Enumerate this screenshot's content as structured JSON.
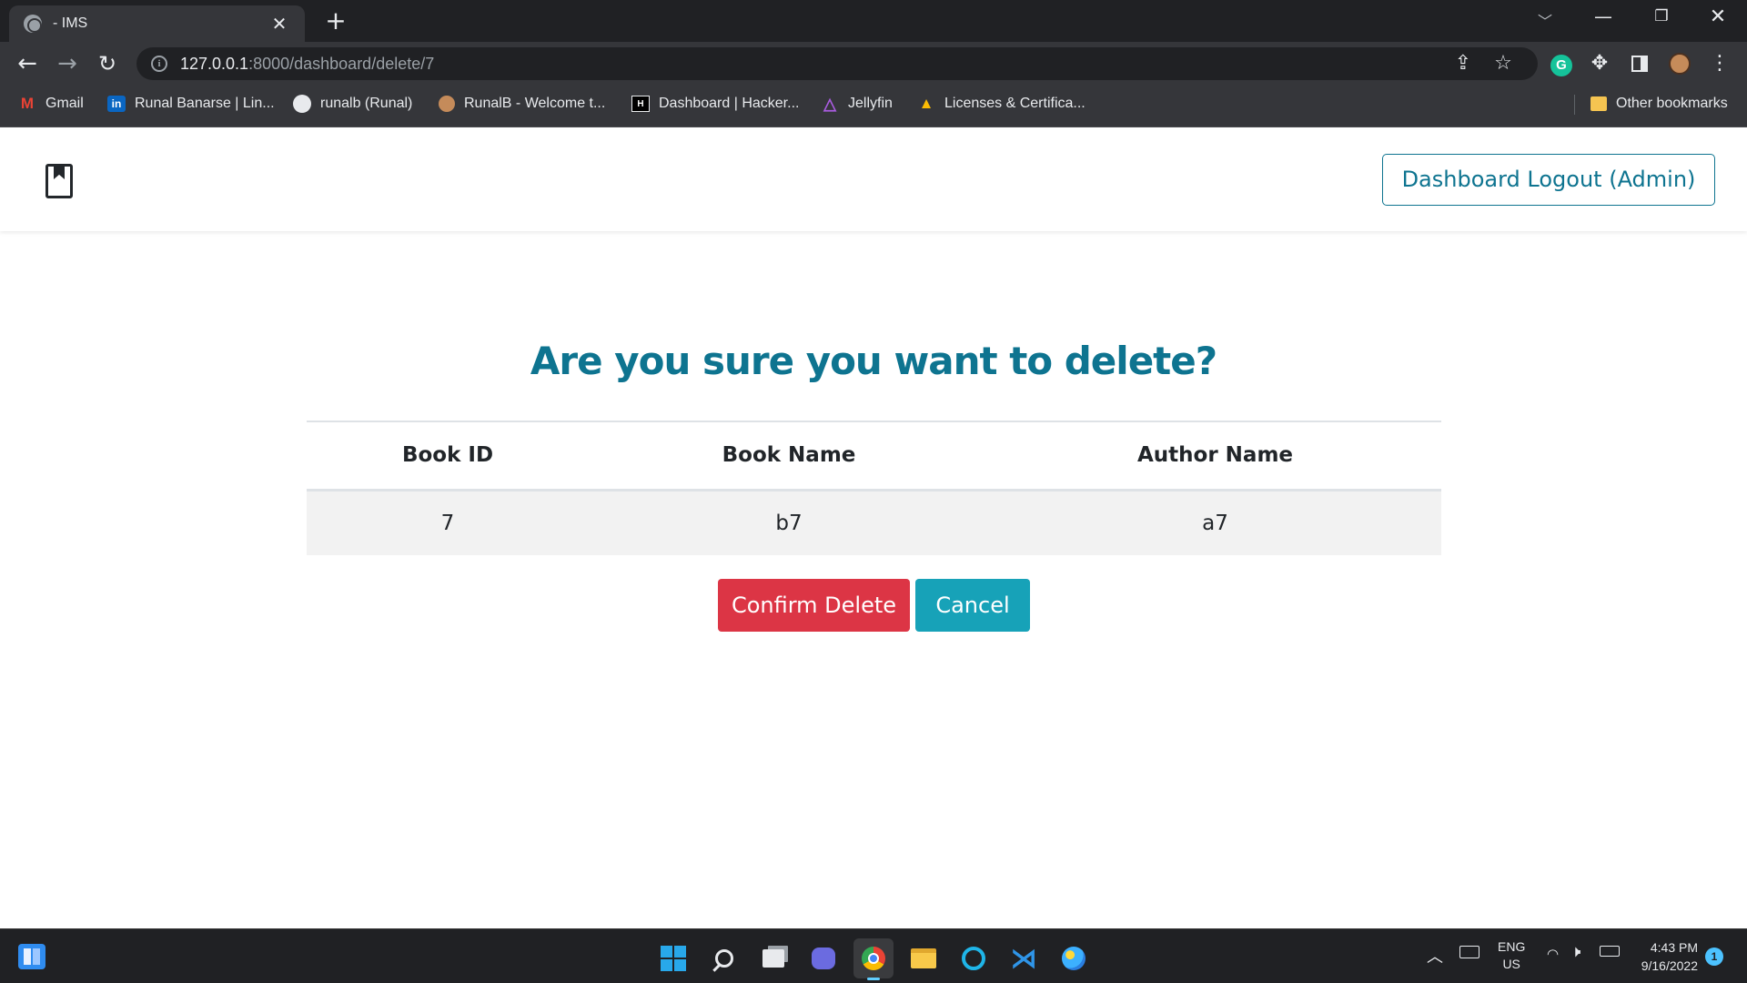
{
  "browser": {
    "tab_title": "- IMS",
    "url_host": "127.0.0.1",
    "url_path": ":8000/dashboard/delete/7",
    "bookmarks": [
      {
        "label": "Gmail",
        "icon": "gmail-icon"
      },
      {
        "label": "Runal Banarse | Lin...",
        "icon": "linkedin-icon"
      },
      {
        "label": "runalb (Runal)",
        "icon": "github-icon"
      },
      {
        "label": "RunalB - Welcome t...",
        "icon": "avatar-icon"
      },
      {
        "label": "Dashboard | Hacker...",
        "icon": "hackerrank-icon"
      },
      {
        "label": "Jellyfin",
        "icon": "jellyfin-icon"
      },
      {
        "label": "Licenses & Certifica...",
        "icon": "google-drive-icon"
      }
    ],
    "other_bookmarks": "Other bookmarks"
  },
  "navbar": {
    "logout_label": "Dashboard Logout (Admin)"
  },
  "page": {
    "heading": "Are you sure you want to delete?",
    "table": {
      "headers": [
        "Book ID",
        "Book Name",
        "Author Name"
      ],
      "rows": [
        [
          "7",
          "b7",
          "a7"
        ]
      ]
    },
    "confirm_label": "Confirm Delete",
    "cancel_label": "Cancel"
  },
  "colors": {
    "accent": "#0e7490",
    "danger": "#dc3545",
    "info": "#17a2b8"
  },
  "taskbar": {
    "lang_line1": "ENG",
    "lang_line2": "US",
    "time": "4:43 PM",
    "date": "9/16/2022",
    "notification_count": "1"
  }
}
